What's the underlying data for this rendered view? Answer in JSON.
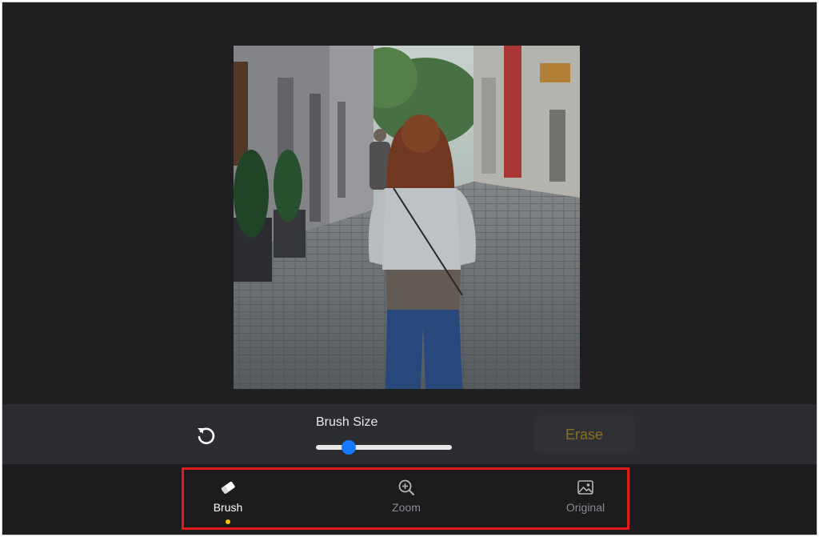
{
  "editor": {
    "brush_size_label": "Brush Size",
    "brush_size_fraction": 0.24,
    "erase_label": "Erase"
  },
  "nav": {
    "items": [
      {
        "label": "Brush",
        "icon": "eraser-icon",
        "active": true
      },
      {
        "label": "Zoom",
        "icon": "zoom-in-icon",
        "active": false
      },
      {
        "label": "Original",
        "icon": "image-icon",
        "active": false
      }
    ]
  },
  "colors": {
    "accent": "#1677ff",
    "active_dot": "#f2c200",
    "highlight_box": "#e11b1b",
    "erase_text": "#8d6d1e"
  }
}
